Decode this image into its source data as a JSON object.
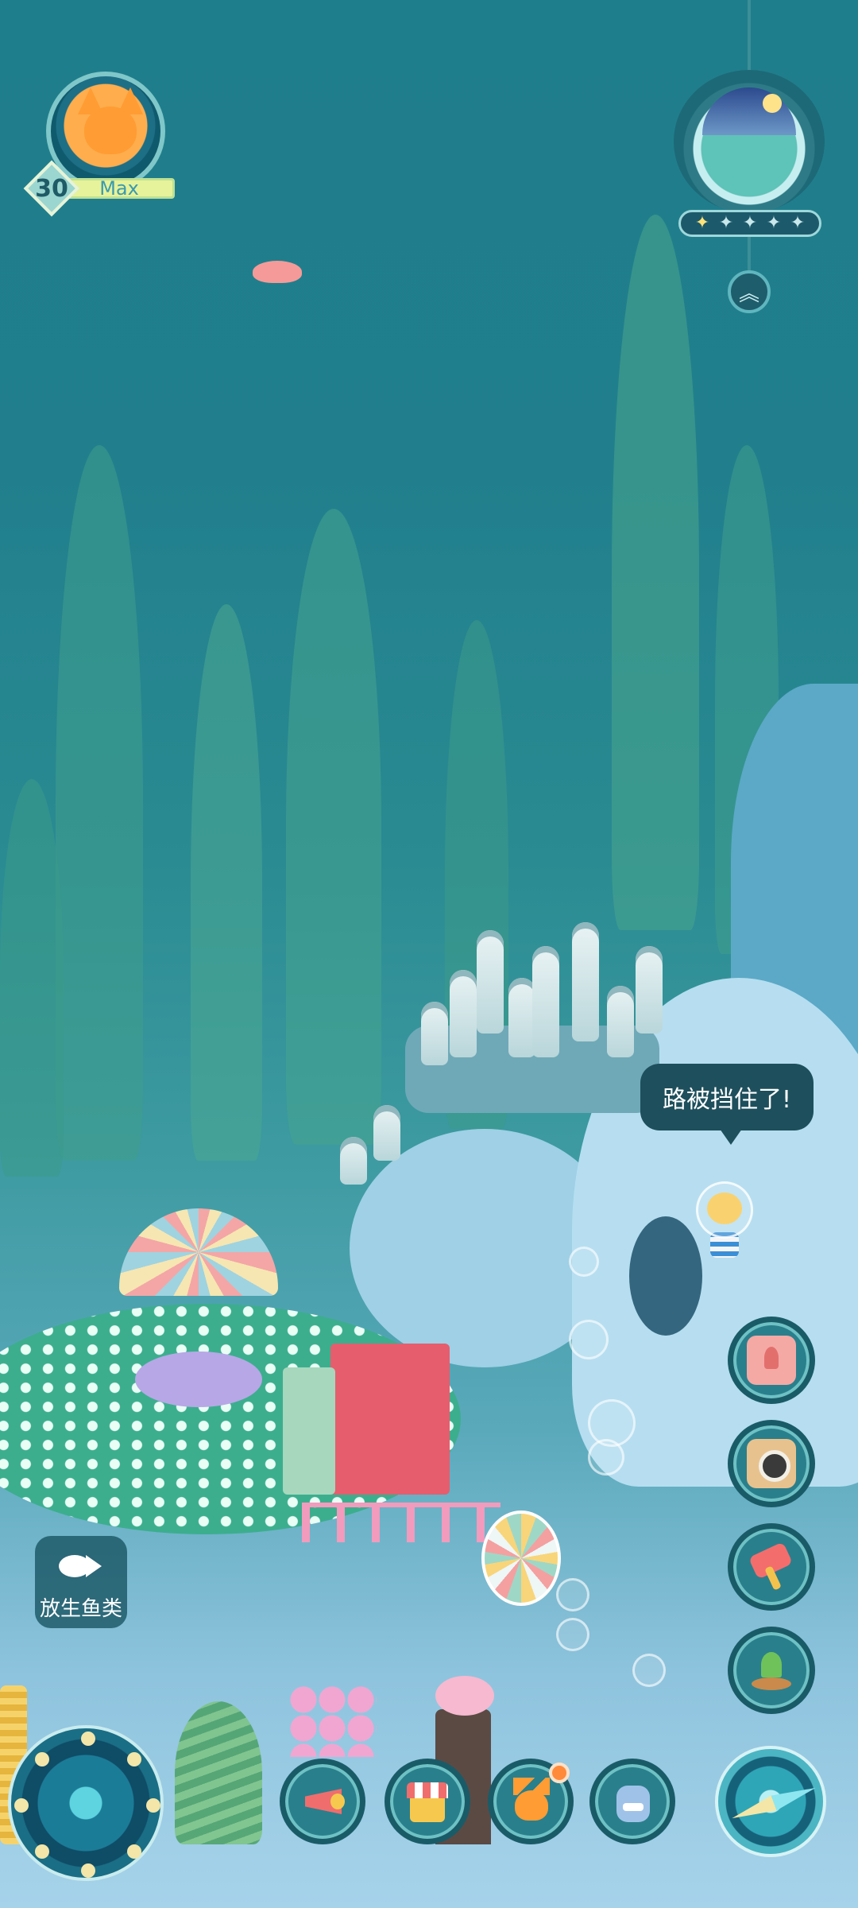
{
  "player": {
    "level": "30",
    "xp_label": "Max",
    "xp_fraction": 1.0,
    "avatar_icon": "fox-avatar-icon"
  },
  "badge": {
    "icon": "ocean-scene-badge-icon",
    "stars_total": 5,
    "stars_filled": 1,
    "star_glyph": "✦",
    "up_glyph": "︽"
  },
  "npc": {
    "speech": "路被挡住了!"
  },
  "side_menu": [
    {
      "name": "collection-book-button",
      "icon": "tulip-book-icon"
    },
    {
      "name": "camera-button",
      "icon": "camera-icon"
    },
    {
      "name": "build-hammer-button",
      "icon": "hammer-icon"
    },
    {
      "name": "plant-button",
      "icon": "sprout-icon"
    }
  ],
  "release_fish": {
    "label": "放生鱼类",
    "icon": "fish-icon"
  },
  "bottom_bar": [
    {
      "name": "announcement-button",
      "icon": "megaphone-icon",
      "badge": false
    },
    {
      "name": "shop-button",
      "icon": "shop-icon",
      "badge": false
    },
    {
      "name": "friends-button",
      "icon": "fox-icon",
      "badge": true
    },
    {
      "name": "backpack-button",
      "icon": "backpack-icon",
      "badge": false
    }
  ],
  "colors": {
    "accent_ring": "#6ec1c4",
    "button_bg": "#2a7f8c",
    "notification": "#ff8a3c",
    "speech_bg": "#1e4f5c"
  }
}
